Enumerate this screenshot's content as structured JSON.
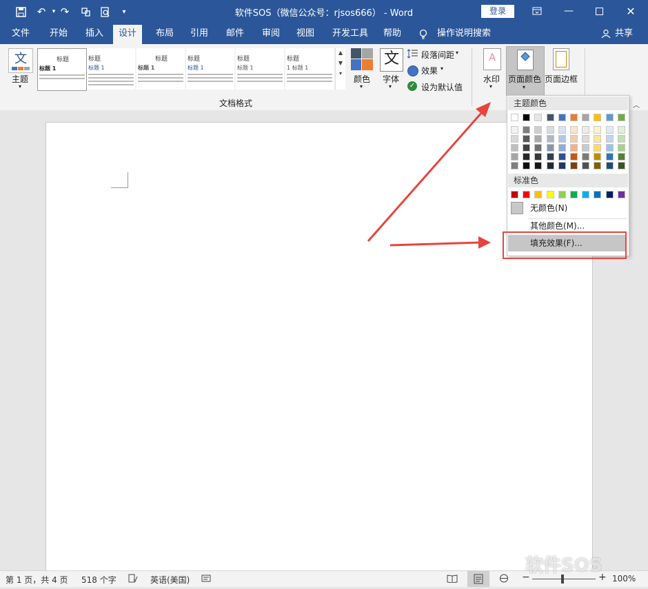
{
  "titlebar": {
    "title": "软件SOS（微信公众号：rjsos666） - Word",
    "login_label": "登录",
    "bg_color": "#2b579a"
  },
  "tabs": [
    {
      "label": "文件"
    },
    {
      "label": "开始"
    },
    {
      "label": "插入"
    },
    {
      "label": "设计"
    },
    {
      "label": "布局"
    },
    {
      "label": "引用"
    },
    {
      "label": "邮件"
    },
    {
      "label": "审阅"
    },
    {
      "label": "视图"
    },
    {
      "label": "开发工具"
    },
    {
      "label": "帮助"
    }
  ],
  "tell_me": "操作说明搜索",
  "share_label": "共享",
  "ribbon": {
    "theme_label": "主题",
    "theme_icon_text": "文",
    "gallery": [
      {
        "title": "标题",
        "subtitle": "标题 1"
      },
      {
        "title": "标题",
        "subtitle": "标题 1"
      },
      {
        "title": "标题",
        "subtitle": "标题 1"
      },
      {
        "title": "标题",
        "subtitle": "标题 1"
      },
      {
        "title": "标题",
        "subtitle": "标题 1"
      },
      {
        "title": "标题",
        "subtitle": "1 标题 1"
      }
    ],
    "group_label": "文档格式",
    "colors_label": "颜色",
    "fonts_label": "字体",
    "fonts_icon_text": "文",
    "paragraph_spacing": "段落间距",
    "effects": "效果",
    "set_default": "设为默认值",
    "watermark": "水印",
    "page_color": "页面颜色",
    "page_borders": "页面边框"
  },
  "dropdown": {
    "theme_colors_header": "主题颜色",
    "theme_top_row": [
      "#ffffff",
      "#000000",
      "#e7e6e6",
      "#44546a",
      "#4472c4",
      "#ed7d31",
      "#a5a5a5",
      "#ffc000",
      "#5b9bd5",
      "#70ad47"
    ],
    "theme_shades": [
      [
        "#f2f2f2",
        "#808080",
        "#d0cece",
        "#d6dce4",
        "#d9e2f3",
        "#fbe5d5",
        "#ededed",
        "#fff2cc",
        "#deebf6",
        "#e2efd9"
      ],
      [
        "#d8d8d8",
        "#595959",
        "#aeabab",
        "#adb9ca",
        "#b4c6e7",
        "#f7cbac",
        "#dbdbdb",
        "#fee599",
        "#bdd7ee",
        "#c5e0b3"
      ],
      [
        "#bfbfbf",
        "#404040",
        "#757070",
        "#8496b0",
        "#8eaadb",
        "#f4b183",
        "#c9c9c9",
        "#ffd965",
        "#9cc3e5",
        "#a8d08d"
      ],
      [
        "#a5a5a5",
        "#262626",
        "#3a3838",
        "#323f4f",
        "#2f5496",
        "#c45911",
        "#7b7b7b",
        "#bf8f00",
        "#2e75b5",
        "#538135"
      ],
      [
        "#7f7f7f",
        "#0d0d0d",
        "#171616",
        "#222a35",
        "#1f3864",
        "#833c0b",
        "#525252",
        "#7f6000",
        "#1e4e79",
        "#375623"
      ]
    ],
    "standard_header": "标准色",
    "standard_colors": [
      "#c00000",
      "#ff0000",
      "#ffc000",
      "#ffff00",
      "#92d050",
      "#00b050",
      "#00b0f0",
      "#0070c0",
      "#002060",
      "#7030a0"
    ],
    "no_color": "无颜色(N)",
    "more_colors": "其他颜色(M)...",
    "fill_effects": "填充效果(F)..."
  },
  "status": {
    "page": "第 1 页，共 4 页",
    "words": "518 个字",
    "language": "英语(美国)",
    "zoom": "100%"
  },
  "watermark_text": "软件SOS",
  "accent_red": "#e8443d"
}
